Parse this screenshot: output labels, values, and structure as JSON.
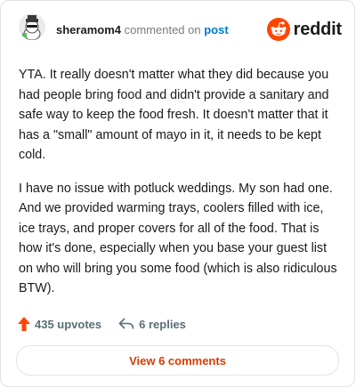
{
  "header": {
    "username": "sheramom4",
    "action_text": "commented on",
    "target_link": "post",
    "brand": "reddit"
  },
  "comment": {
    "paragraphs": [
      "YTA. It really doesn't matter what they did because you had people bring food and didn't provide a sanitary and safe way to keep the food fresh. It doesn't matter that it has a \"small\" amount of mayo in it, it needs to be kept cold.",
      "I have no issue with potluck weddings. My son had one. And we provided warming trays, coolers filled with ice, ice trays, and proper covers for all of the food. That is how it's done, especially when you base your guest list on who will bring you some food (which is also ridiculous BTW)."
    ]
  },
  "actions": {
    "upvotes": "435 upvotes",
    "replies": "6 replies"
  },
  "footer": {
    "view_button": "View 6 comments"
  },
  "colors": {
    "accent": "#ff4500",
    "link": "#0079d3",
    "button_text": "#d93a00"
  },
  "icons": {
    "avatar": "snoo-avatar-icon",
    "brand": "reddit-logo-icon",
    "upvote": "upvote-arrow-icon",
    "reply": "reply-arrow-icon"
  }
}
